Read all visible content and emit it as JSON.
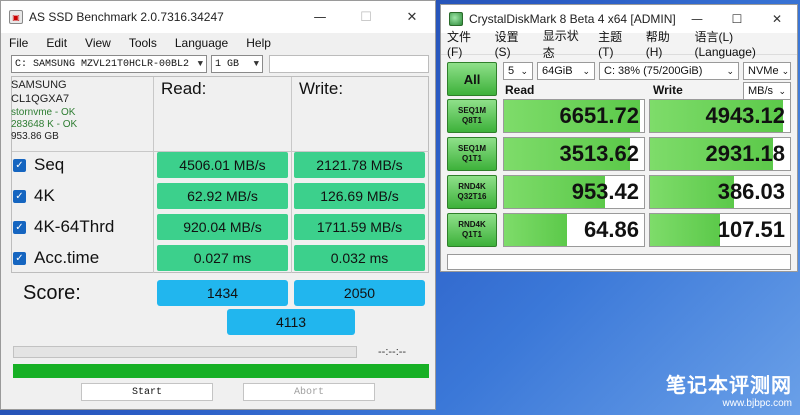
{
  "asssd": {
    "title": "AS SSD Benchmark 2.0.7316.34247",
    "window_controls": {
      "minimize": "—",
      "maximize": "☐",
      "close": "✕"
    },
    "menu": [
      "File",
      "Edit",
      "View",
      "Tools",
      "Language",
      "Help"
    ],
    "drive_select": "C: SAMSUNG MZVL21T0HCLR-00BL2",
    "size_select": "1 GB",
    "info": {
      "vendor": "SAMSUNG",
      "firmware": "CL1QGXA7",
      "driver": "stornvme - OK",
      "alignment": "283648 K - OK",
      "capacity": "953.86 GB"
    },
    "headers": {
      "read": "Read:",
      "write": "Write:"
    },
    "tests": [
      {
        "label": "Seq",
        "read": "4506.01 MB/s",
        "write": "2121.78 MB/s"
      },
      {
        "label": "4K",
        "read": "62.92 MB/s",
        "write": "126.69 MB/s"
      },
      {
        "label": "4K-64Thrd",
        "read": "920.04 MB/s",
        "write": "1711.59 MB/s"
      },
      {
        "label": "Acc.time",
        "read": "0.027 ms",
        "write": "0.032 ms"
      }
    ],
    "score": {
      "label": "Score:",
      "read": "1434",
      "write": "2050",
      "total": "4113"
    },
    "time_text": "--:--:--",
    "progress_fraction": 1.0,
    "start_label": "Start",
    "abort_label": "Abort",
    "colors": {
      "result": "#3cd08c",
      "score": "#21b6ee",
      "progress": "#17b025"
    }
  },
  "cdm": {
    "title": "CrystalDiskMark 8 Beta 4 x64 [ADMIN]",
    "window_controls": {
      "minimize": "—",
      "maximize": "☐",
      "close": "✕"
    },
    "menu": [
      "文件(F)",
      "设置(S)",
      "显示状态",
      "主题(T)",
      "帮助(H)",
      "语言(L)(Language)"
    ],
    "all_label": "All",
    "count_select": "5",
    "size_select": "64GiB",
    "drive_select": "C: 38% (75/200GiB)",
    "mode_select": "NVMe",
    "unit_select": "MB/s",
    "read_header": "Read",
    "write_header": "Write",
    "rows": [
      {
        "line1": "SEQ1M",
        "line2": "Q8T1",
        "read": "6651.72",
        "write": "4943.12",
        "read_fill": 0.97,
        "write_fill": 0.95
      },
      {
        "line1": "SEQ1M",
        "line2": "Q1T1",
        "read": "3513.62",
        "write": "2931.18",
        "read_fill": 0.9,
        "write_fill": 0.88
      },
      {
        "line1": "RND4K",
        "line2": "Q32T16",
        "read": "953.42",
        "write": "386.03",
        "read_fill": 0.72,
        "write_fill": 0.6
      },
      {
        "line1": "RND4K",
        "line2": "Q1T1",
        "read": "64.86",
        "write": "107.51",
        "read_fill": 0.45,
        "write_fill": 0.5
      }
    ]
  },
  "watermark": {
    "main": "笔记本评测网",
    "sub": "www.bjbpc.com"
  }
}
